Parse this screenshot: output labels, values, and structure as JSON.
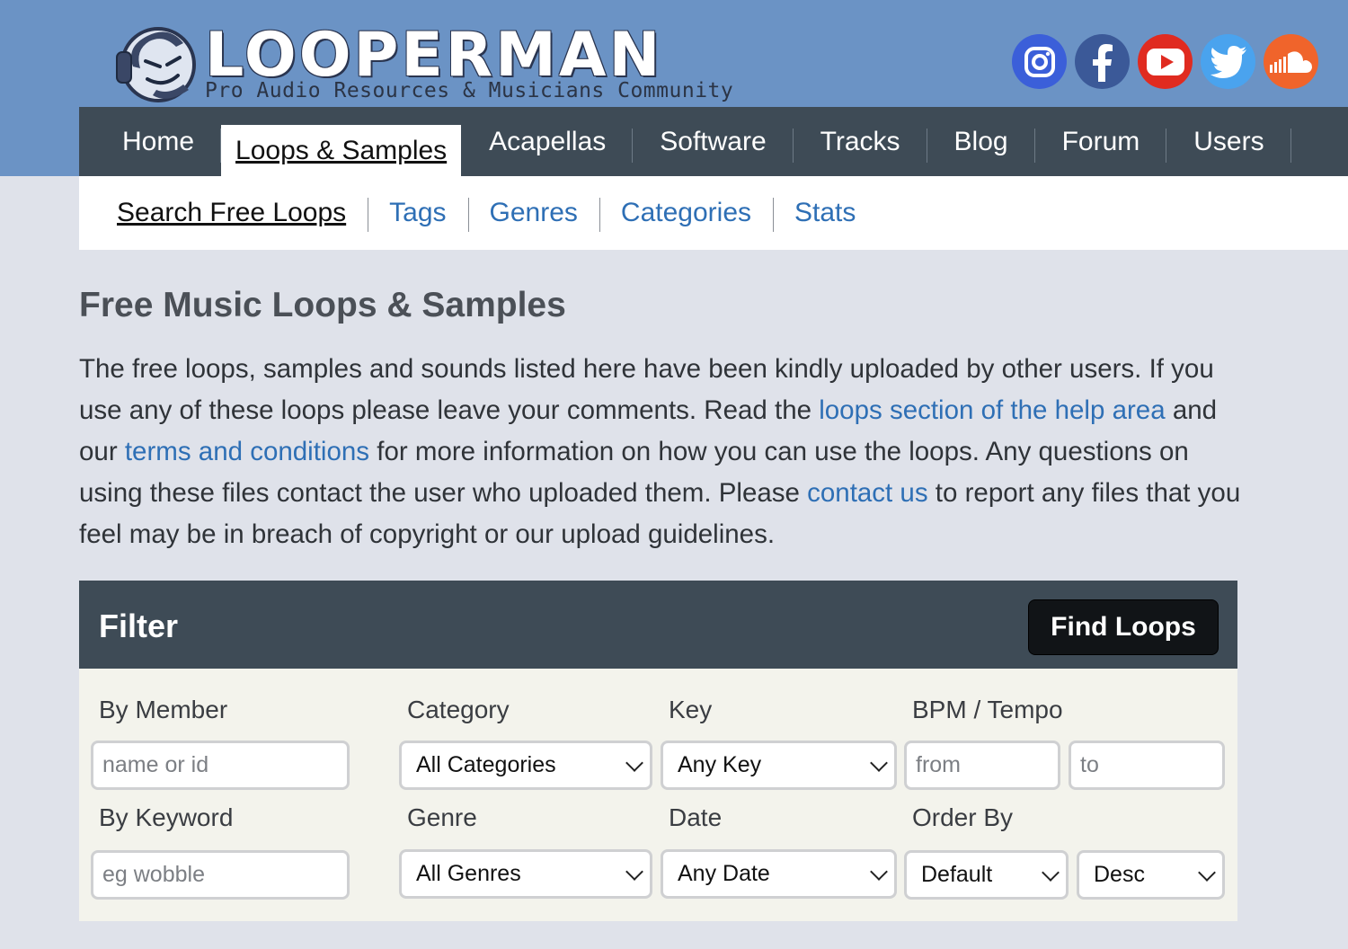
{
  "brand": {
    "name": "LOOPERMAN",
    "tagline": "Pro Audio Resources & Musicians Community"
  },
  "social": [
    {
      "icon": "instagram-icon",
      "color": "#3b5fd9"
    },
    {
      "icon": "facebook-icon",
      "color": "#3b5998"
    },
    {
      "icon": "youtube-icon",
      "color": "#e02b20"
    },
    {
      "icon": "twitter-icon",
      "color": "#4aa3ee"
    },
    {
      "icon": "soundcloud-icon",
      "color": "#f0642b"
    }
  ],
  "nav": {
    "items": [
      "Home",
      "Loops & Samples",
      "Acapellas",
      "Software",
      "Tracks",
      "Blog",
      "Forum",
      "Users"
    ],
    "active": "Loops & Samples"
  },
  "subnav": {
    "items": [
      "Search Free Loops",
      "Tags",
      "Genres",
      "Categories",
      "Stats"
    ]
  },
  "page": {
    "title": "Free Music Loops & Samples",
    "intro_1": "The free loops, samples and sounds listed here have been kindly uploaded by other users. If you use any of these loops please leave your comments. Read the ",
    "link_help": "loops section of the help area",
    "intro_2": " and our ",
    "link_terms": "terms and conditions",
    "intro_3": " for more information on how you can use the loops. Any questions on using these files contact the user who uploaded them. Please ",
    "link_contact": "contact us",
    "intro_4": " to report any files that you feel may be in breach of copyright or our upload guidelines."
  },
  "filter": {
    "title": "Filter",
    "button": "Find Loops",
    "member_label": "By Member",
    "member_placeholder": "name or id",
    "keyword_label": "By Keyword",
    "keyword_placeholder": "eg wobble",
    "category_label": "Category",
    "category_value": "All Categories",
    "genre_label": "Genre",
    "genre_value": "All Genres",
    "key_label": "Key",
    "key_value": "Any Key",
    "date_label": "Date",
    "date_value": "Any Date",
    "bpm_label": "BPM / Tempo",
    "bpm_from_placeholder": "from",
    "bpm_to_placeholder": "to",
    "order_label": "Order By",
    "order_value": "Default",
    "direction_value": "Desc"
  },
  "colors": {
    "header_bg": "#6b93c5",
    "nav_bg": "#3e4b56",
    "link": "#2e6fb5",
    "page_bg": "#dfe2ea"
  }
}
